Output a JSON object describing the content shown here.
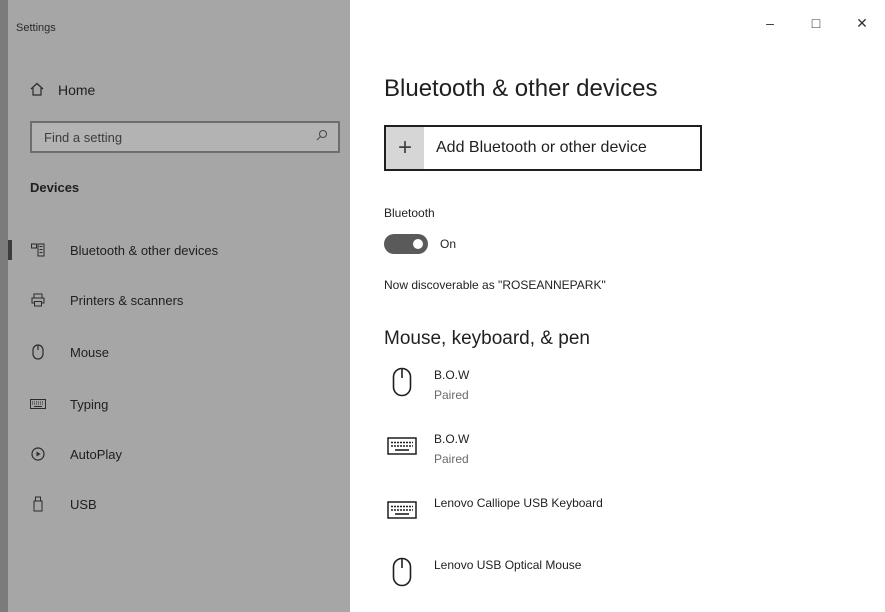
{
  "window": {
    "title": "Settings",
    "controls": {
      "minimize": "–",
      "maximize": "□",
      "close": "✕"
    }
  },
  "sidebar": {
    "home_label": "Home",
    "home_icon": "home-icon",
    "search": {
      "placeholder": "Find a setting",
      "icon": "search-icon"
    },
    "section_label": "Devices",
    "items": [
      {
        "label": "Bluetooth & other devices",
        "icon": "bluetooth-devices-icon",
        "active": true
      },
      {
        "label": "Printers & scanners",
        "icon": "printer-icon",
        "active": false
      },
      {
        "label": "Mouse",
        "icon": "mouse-icon",
        "active": false
      },
      {
        "label": "Typing",
        "icon": "keyboard-icon",
        "active": false
      },
      {
        "label": "AutoPlay",
        "icon": "autoplay-icon",
        "active": false
      },
      {
        "label": "USB",
        "icon": "usb-icon",
        "active": false
      }
    ]
  },
  "main": {
    "title": "Bluetooth & other devices",
    "add_button": {
      "symbol": "+",
      "label": "Add Bluetooth or other device"
    },
    "bluetooth": {
      "label": "Bluetooth",
      "toggle_state": "On",
      "discoverable_text": "Now discoverable as \"ROSEANNEPARK\""
    },
    "devices_section": {
      "title": "Mouse, keyboard, & pen",
      "devices": [
        {
          "name": "B.O.W",
          "status": "Paired",
          "icon": "mouse-icon"
        },
        {
          "name": "B.O.W",
          "status": "Paired",
          "icon": "keyboard-icon"
        },
        {
          "name": "Lenovo Calliope USB Keyboard",
          "status": "",
          "icon": "keyboard-icon"
        },
        {
          "name": "Lenovo USB Optical Mouse",
          "status": "",
          "icon": "mouse-icon"
        }
      ]
    }
  },
  "colors": {
    "sidebar_bg": "#a6a6a6",
    "toggle_on": "#5a5a5a",
    "content_bg": "#ffffff"
  }
}
